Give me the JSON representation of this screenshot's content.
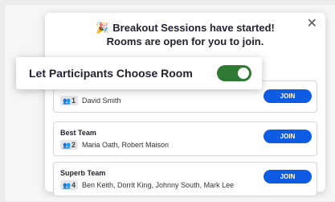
{
  "header": {
    "line1": "Breakout Sessions have started!",
    "line2": "Rooms are open for you to join.",
    "icon": "party-popper-icon",
    "close_symbol": "✕"
  },
  "toggle_banner": {
    "label": "Let Participants Choose Room",
    "enabled": true,
    "color": "#2f7a33"
  },
  "rooms": [
    {
      "name": "",
      "count": "1",
      "participants": "David Smith",
      "join_label": "JOIN"
    },
    {
      "name": "Best Team",
      "count": "2",
      "participants": "Maria Oath, Robert Maison",
      "join_label": "JOIN"
    },
    {
      "name": "Superb Team",
      "count": "4",
      "participants": "Ben Keith, Dorrit King, Johnny South, Mark Lee",
      "join_label": "JOIN"
    }
  ],
  "colors": {
    "join_button": "#0e5be4"
  }
}
